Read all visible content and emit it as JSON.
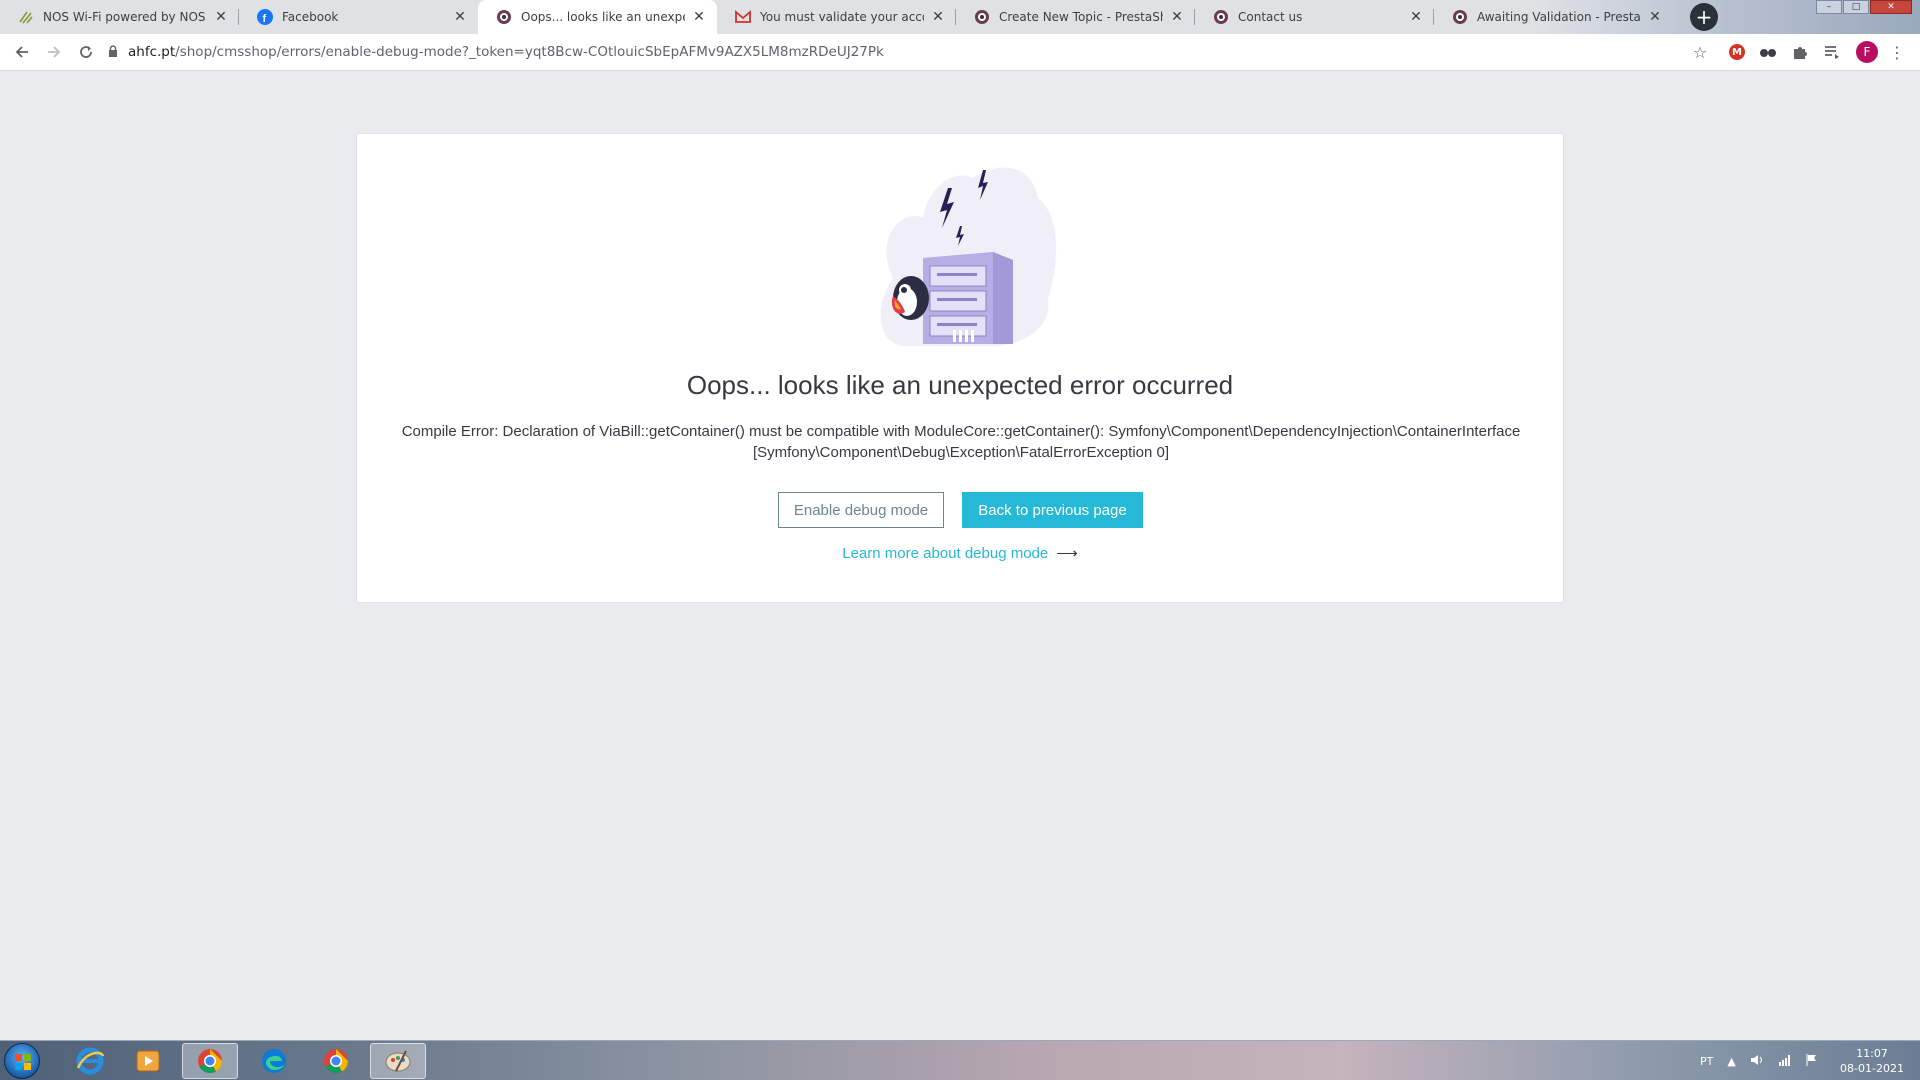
{
  "browser": {
    "tabs": [
      {
        "title": "NOS Wi-Fi powered by NOS - Home",
        "icon": "nos-favicon-icon"
      },
      {
        "title": "Facebook",
        "icon": "facebook-icon"
      },
      {
        "title": "Oops... looks like an unexpected error",
        "icon": "prestashop-icon"
      },
      {
        "title": "You must validate your account to c",
        "icon": "gmail-icon"
      },
      {
        "title": "Create New Topic - PrestaShop For",
        "icon": "prestashop-icon"
      },
      {
        "title": "Contact us",
        "icon": "prestashop-icon"
      },
      {
        "title": "Awaiting Validation - PrestaShop Fo",
        "icon": "prestashop-icon"
      }
    ],
    "active_tab_index": 2,
    "url_host": "ahfc.pt",
    "url_path": "/shop/cmsshop/errors/enable-debug-mode?_token=yqt8Bcw-COtlouicSbEpAFMv9AZX5LM8mzRDeUJ27Pk",
    "profile_initial": "F",
    "extension_badge": "M"
  },
  "page": {
    "headline": "Oops... looks like an unexpected error occurred",
    "error_message": "Compile Error: Declaration of ViaBill::getContainer() must be compatible with ModuleCore::getContainer(): Symfony\\Component\\DependencyInjection\\ContainerInterface [Symfony\\Component\\Debug\\Exception\\FatalErrorException 0]",
    "enable_debug_label": "Enable debug mode",
    "back_label": "Back to previous page",
    "learn_more_label": "Learn more about debug mode",
    "learn_more_arrow": "⟶"
  },
  "taskbar": {
    "language": "PT",
    "time": "11:07",
    "date": "08-01-2021"
  },
  "colors": {
    "accent": "#25b9d7",
    "text": "#363a41",
    "page_bg": "#e9ebef",
    "illustration_purple": "#c8c0ec"
  }
}
